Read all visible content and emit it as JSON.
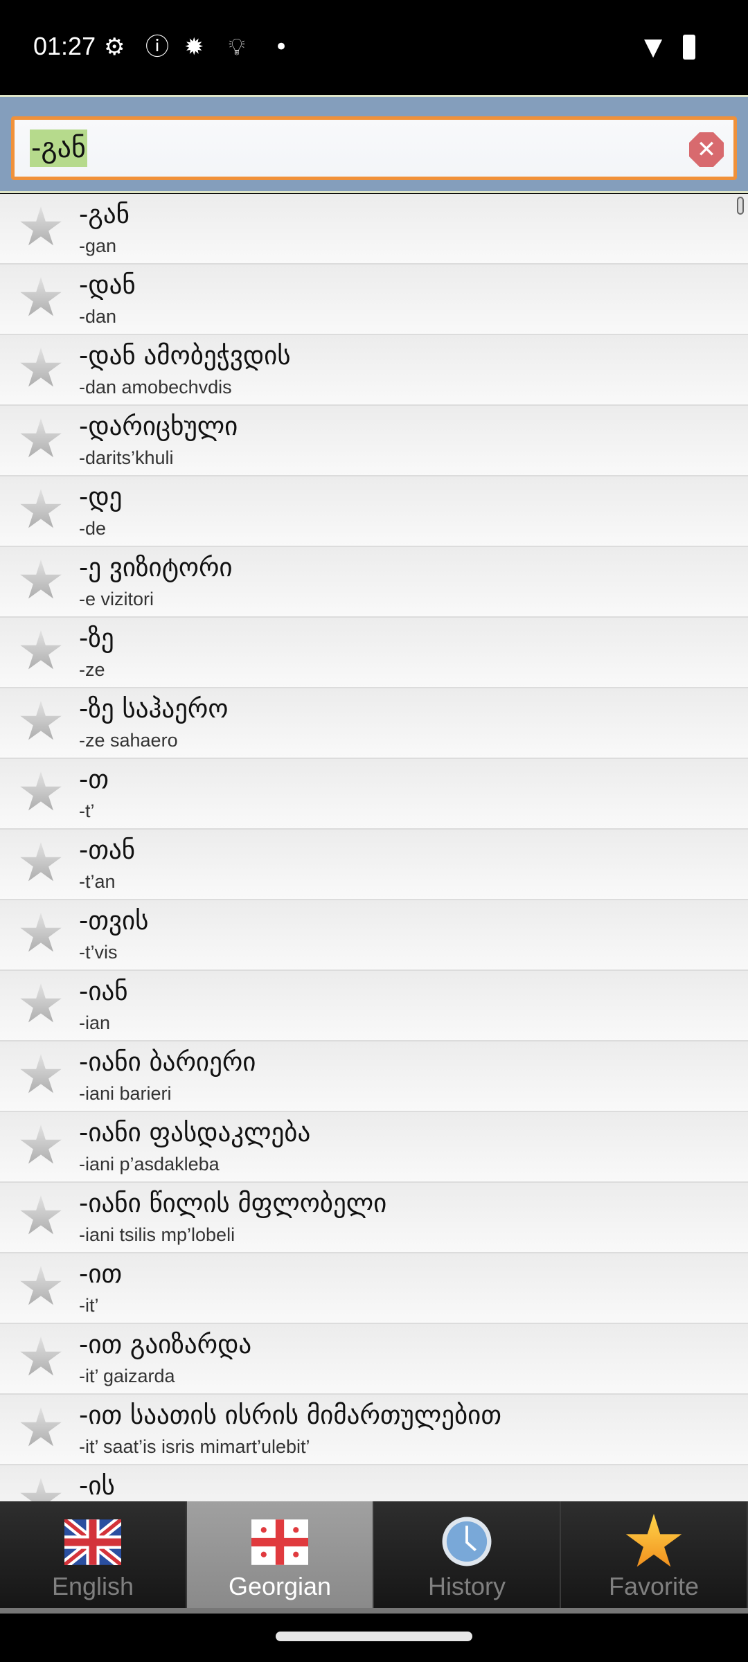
{
  "status_bar": {
    "time": "01:27"
  },
  "search": {
    "value": "-გან"
  },
  "entries": [
    {
      "word": "-გან",
      "translit": "-gan"
    },
    {
      "word": "-დან",
      "translit": "-dan"
    },
    {
      "word": "-დან ამობეჭვდის",
      "translit": "-dan amobechvdis"
    },
    {
      "word": "-დარიცხული",
      "translit": "-darits’khuli"
    },
    {
      "word": "-დე",
      "translit": "-de"
    },
    {
      "word": "-ე ვიზიტორი",
      "translit": "-e vizitori"
    },
    {
      "word": "-ზე",
      "translit": "-ze"
    },
    {
      "word": "-ზე საჰაერო",
      "translit": "-ze sahaero"
    },
    {
      "word": "-თ",
      "translit": "-t’"
    },
    {
      "word": "-თან",
      "translit": "-t’an"
    },
    {
      "word": "-თვის",
      "translit": "-t’vis"
    },
    {
      "word": "-იან",
      "translit": "-ian"
    },
    {
      "word": "-იანი ბარიერი",
      "translit": "-iani barieri"
    },
    {
      "word": "-იანი ფასდაკლება",
      "translit": "-iani p’asdakleba"
    },
    {
      "word": "-იანი წილის მფლობელი",
      "translit": "-iani tsilis mp’lobeli"
    },
    {
      "word": "-ით",
      "translit": "-it’"
    },
    {
      "word": "-ით გაიზარდა",
      "translit": "-it’ gaizarda"
    },
    {
      "word": "-ით საათის ისრის მიმართულებით",
      "translit": "-it’ saat’is isris mimart’ulebit’"
    },
    {
      "word": "-ის",
      "translit": ""
    }
  ],
  "tabs": [
    {
      "label": "English",
      "icon": "uk-flag-icon"
    },
    {
      "label": "Georgian",
      "icon": "georgia-flag-icon",
      "active": true
    },
    {
      "label": "History",
      "icon": "clock-icon"
    },
    {
      "label": "Favorite",
      "icon": "star-icon"
    }
  ],
  "colors": {
    "header": "#849ebc",
    "search_border": "#f0913a",
    "highlight": "#b6da8c",
    "favorite": "#f5a623"
  }
}
